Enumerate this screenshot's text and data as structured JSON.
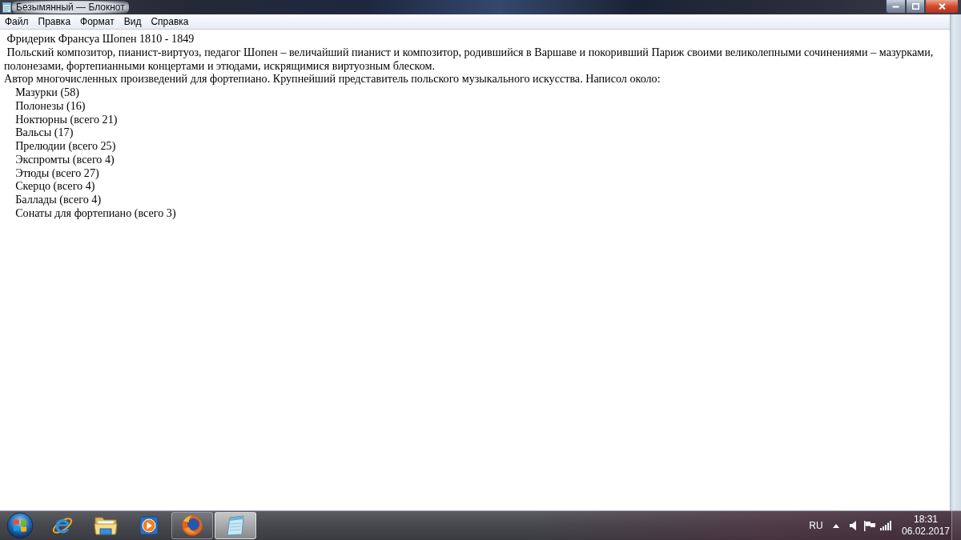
{
  "window": {
    "title": "Безымянный — Блокнот"
  },
  "menu": [
    {
      "label": "Файл"
    },
    {
      "label": "Правка"
    },
    {
      "label": "Формат"
    },
    {
      "label": "Вид"
    },
    {
      "label": "Справка"
    }
  ],
  "document": {
    "lines": [
      {
        "kind": "text",
        "text": " Фридерик Франсуа Шопен 1810 - 1849"
      },
      {
        "kind": "text",
        "text": " Польский композитор, пианист-виртуоз, педагог Шопен – величайший пианист и композитор, родившийся в Варшаве и покоривший Париж своими великолепными сочинениями – мазурками, полонезами, фортепианными концертами и этюдами, искрящимися виртуозным блеском."
      },
      {
        "kind": "text",
        "text": "Автор многочисленных произведений для фортепиано. Крупнейший представитель польского музыкального искусства. Написол около:"
      },
      {
        "kind": "item",
        "text": "Мазурки (58)"
      },
      {
        "kind": "item",
        "text": "Полонезы (16)"
      },
      {
        "kind": "item",
        "text": "Ноктюрны (всего 21)"
      },
      {
        "kind": "item",
        "text": "Вальсы (17)"
      },
      {
        "kind": "item",
        "text": "Прелюдии (всего 25)"
      },
      {
        "kind": "item",
        "text": "Экспромты (всего 4)"
      },
      {
        "kind": "item",
        "text": "Этюды (всего 27)"
      },
      {
        "kind": "item",
        "text": "Скерцо (всего 4)"
      },
      {
        "kind": "item",
        "text": "Баллады (всего 4)"
      },
      {
        "kind": "item",
        "text": "Сонаты для фортепиано (всего 3)"
      }
    ]
  },
  "taskbar": {
    "apps": [
      {
        "kind": "ie",
        "open": false,
        "selected": false
      },
      {
        "kind": "folder",
        "open": false,
        "selected": false
      },
      {
        "kind": "player",
        "open": false,
        "selected": false
      },
      {
        "kind": "firefox",
        "open": true,
        "selected": false
      },
      {
        "kind": "notepad",
        "open": true,
        "selected": true
      }
    ]
  },
  "tray": {
    "language": "RU",
    "time": "18:31",
    "date": "06.02.2017"
  }
}
